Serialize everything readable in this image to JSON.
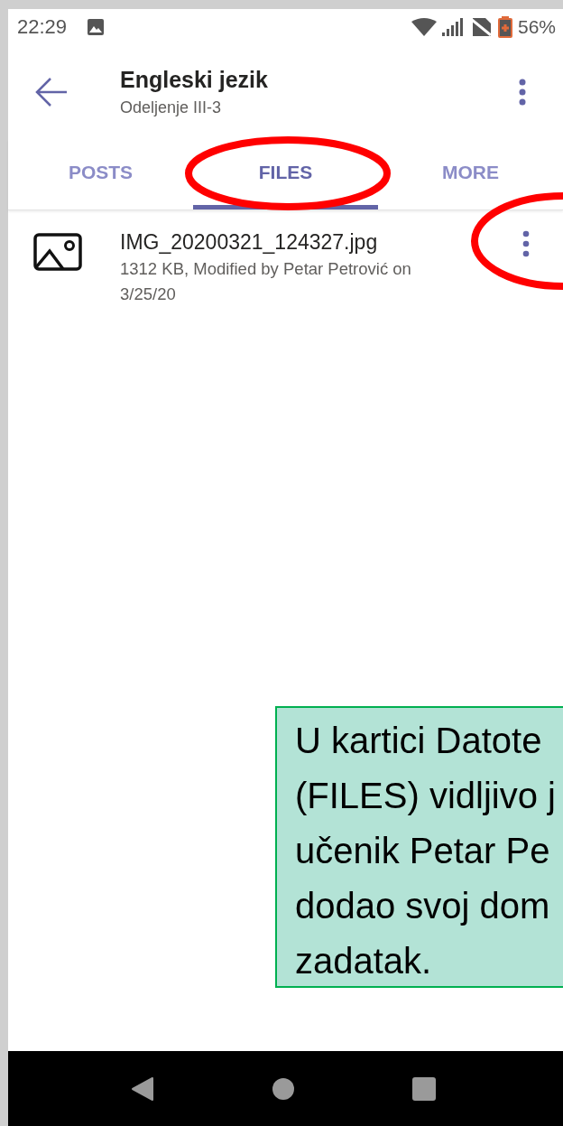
{
  "status_bar": {
    "time": "22:29",
    "battery_text": "56%"
  },
  "header": {
    "title": "Engleski jezik",
    "subtitle": "Odeljenje III-3"
  },
  "tabs": [
    {
      "label": "POSTS",
      "selected": false
    },
    {
      "label": "FILES",
      "selected": true
    },
    {
      "label": "MORE",
      "selected": false
    }
  ],
  "files": [
    {
      "name": "IMG_20200321_124327.jpg",
      "meta": "1312 KB, Modified by Petar Petrović on 3/25/20"
    }
  ],
  "callout": {
    "lines": [
      "U kartici Datote",
      "(FILES) vidljivo j",
      "učenik Petar Pe",
      "dodao svoj dom",
      "zadatak."
    ]
  }
}
